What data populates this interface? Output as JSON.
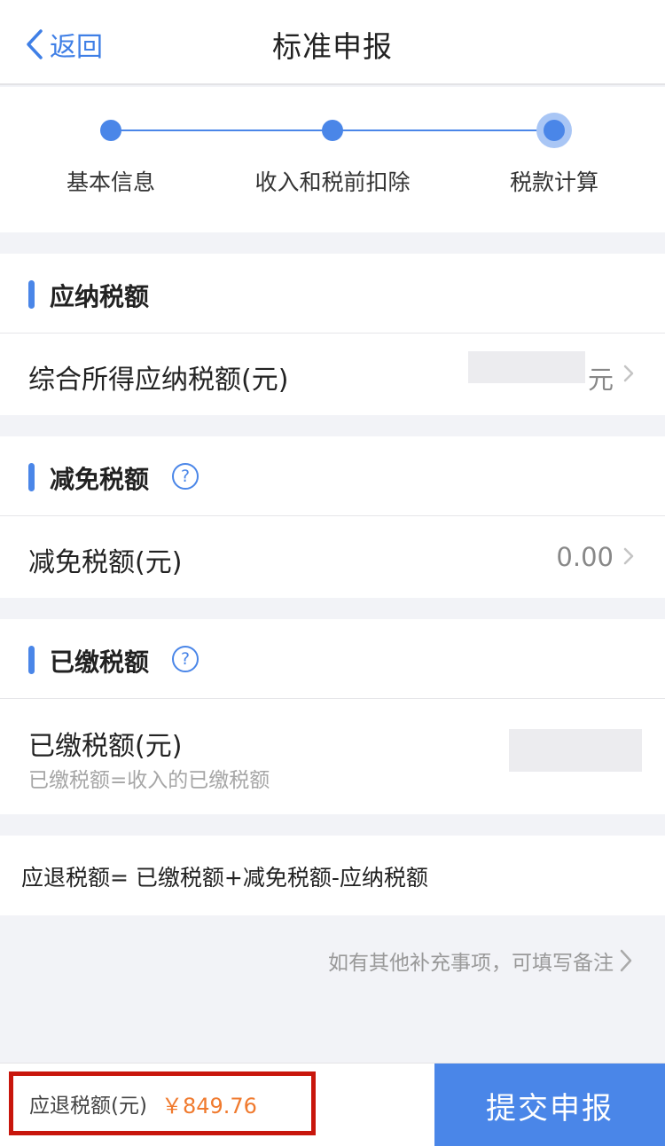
{
  "nav": {
    "back_label": "返回",
    "title": "标准申报"
  },
  "steps": [
    {
      "label": "基本信息"
    },
    {
      "label": "收入和税前扣除"
    },
    {
      "label": "税款计算"
    }
  ],
  "taxable": {
    "title": "应纳税额",
    "row_label": "综合所得应纳税额(元)",
    "row_value": "元"
  },
  "reduction": {
    "title": "减免税额",
    "help": "?",
    "row_label": "减免税额(元)",
    "row_value": "0.00"
  },
  "paid": {
    "title": "已缴税额",
    "help": "?",
    "row_label": "已缴税额(元)",
    "row_sub": "已缴税额=收入的已缴税额"
  },
  "formula": "应退税额= 已缴税额+减免税额-应纳税额",
  "remark": "如有其他补充事项，可填写备注",
  "bottom": {
    "refund_label": "应退税额(元)",
    "refund_amount": "￥849.76",
    "submit_label": "提交申报"
  },
  "colors": {
    "accent": "#4a86e8",
    "highlight_border": "#c8160c",
    "amount": "#f07a2e"
  }
}
